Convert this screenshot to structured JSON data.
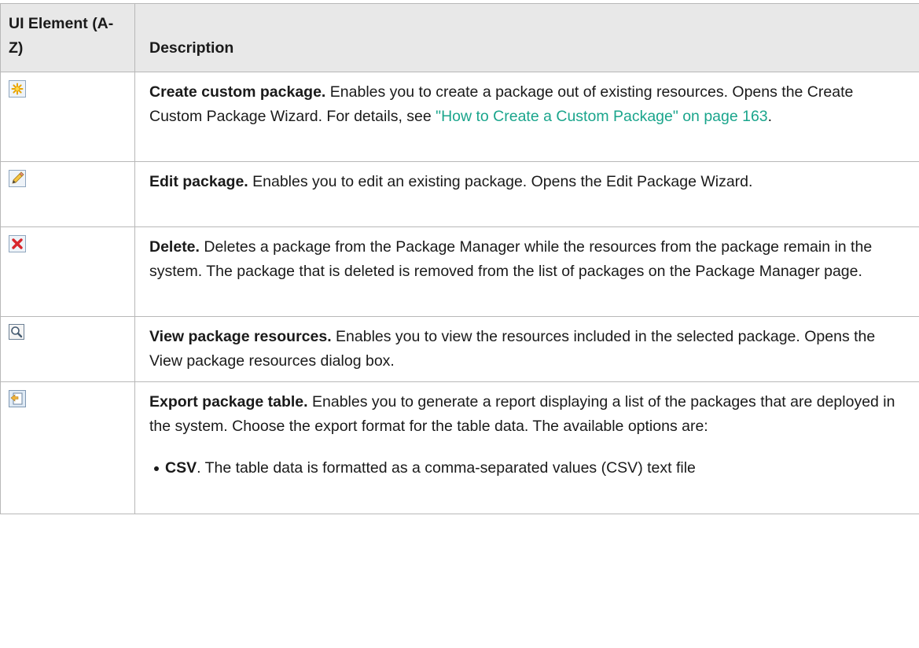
{
  "header": {
    "col1": "UI Element (A-Z)",
    "col2": "Description"
  },
  "rows": [
    {
      "icon": "create-custom-package-icon",
      "term": "Create custom package.",
      "text": " Enables you to create a package out of existing resources. Opens the Create Custom Package Wizard. For details, see ",
      "link": "\"How to Create a Custom Package\" on page 163",
      "after": "."
    },
    {
      "icon": "edit-package-icon",
      "term": "Edit package.",
      "text": " Enables you to edit an existing package. Opens the Edit Package Wizard."
    },
    {
      "icon": "delete-icon",
      "term": "Delete.",
      "text": " Deletes a package from the Package Manager while the resources from the package remain in the system. The package that is deleted is removed from the list of packages on the Package Manager page."
    },
    {
      "icon": "view-resources-icon",
      "term": "View package resources.",
      "text": " Enables you to view the resources included in the selected package. Opens the View package resources dialog box."
    },
    {
      "icon": "export-table-icon",
      "term": "Export package table.",
      "text": " Enables you to generate a report displaying a list of the packages that are deployed in the system. Choose the export format for the table data. The available options are:",
      "options": [
        {
          "term": "CSV",
          "text": ". The table data is formatted as a comma-separated values (CSV) text file"
        }
      ]
    }
  ],
  "colors": {
    "header_bg": "#e8e8e8",
    "border": "#b8b8b8",
    "link": "#1aa58c"
  }
}
